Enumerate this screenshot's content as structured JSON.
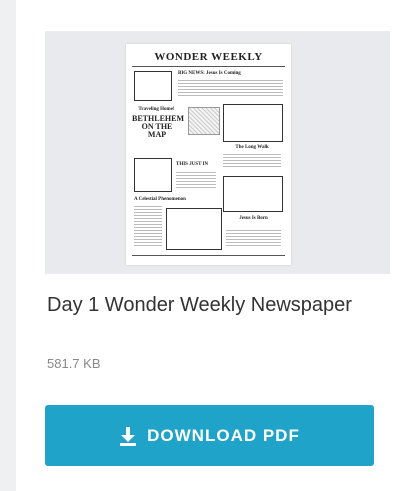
{
  "resource": {
    "title": "Day 1 Wonder Weekly Newspaper",
    "file_size": "581.7 KB",
    "download_label": "DOWNLOAD PDF",
    "download_icon": "download-icon"
  },
  "thumbnail": {
    "masthead": "WONDER WEEKLY",
    "headline_1": "BIG NEWS: Jesus Is Coming",
    "headline_2": "Traveling Home!",
    "headline_3": "BETHLEHEM ON THE MAP",
    "headline_4": "The Long Walk",
    "headline_5": "THIS JUST IN",
    "headline_6": "A Celestial Phenomenon",
    "headline_7": "Jesus Is Born"
  },
  "colors": {
    "accent": "#1fa3c9",
    "page_background": "#eef0f2"
  }
}
